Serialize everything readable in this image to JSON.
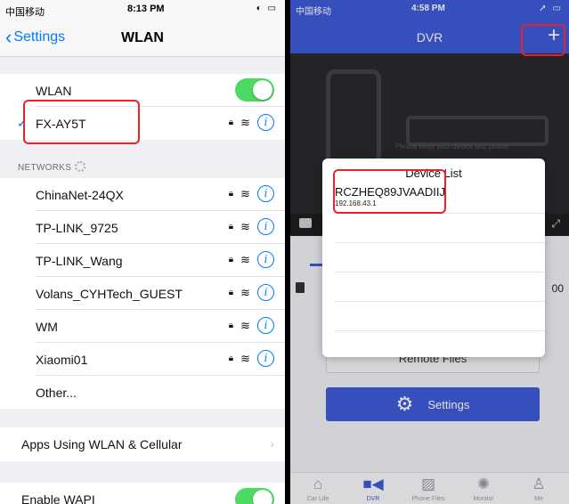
{
  "left": {
    "status": {
      "carrier": "中国移动",
      "time": "8:13 PM"
    },
    "nav": {
      "back_label": "Settings",
      "title": "WLAN"
    },
    "wlan_label": "WLAN",
    "connected_network": "FX-AY5T",
    "networks_header": "NETWORKS",
    "networks": [
      {
        "name": "ChinaNet-24QX"
      },
      {
        "name": "TP-LINK_9725"
      },
      {
        "name": "TP-LINK_Wang"
      },
      {
        "name": "Volans_CYHTech_GUEST"
      },
      {
        "name": "WM"
      },
      {
        "name": "Xiaomi01"
      }
    ],
    "other_label": "Other...",
    "apps_using_label": "Apps Using WLAN & Cellular",
    "enable_wapi_label": "Enable WAPI"
  },
  "right": {
    "status": {
      "carrier": "中国移动",
      "time": "4:58 PM"
    },
    "header_title": "DVR",
    "camera_hint": "Please keep your device and phone",
    "modal": {
      "title": "Device List",
      "device_name": "RCZHEQ89JVAADIIJ",
      "device_ip": "192.168.43.1"
    },
    "side_number": "00",
    "remote_files_label": "Remote Files",
    "settings_label": "Settings",
    "tabs": [
      {
        "label": "Car Life"
      },
      {
        "label": "DVR"
      },
      {
        "label": "Phone Files"
      },
      {
        "label": "Monitor"
      },
      {
        "label": "Me"
      }
    ]
  },
  "colors": {
    "ios_blue": "#007aff",
    "toggle_green": "#4cd964",
    "dvr_blue": "#3d5bd6",
    "highlight_red": "#e8222a"
  }
}
